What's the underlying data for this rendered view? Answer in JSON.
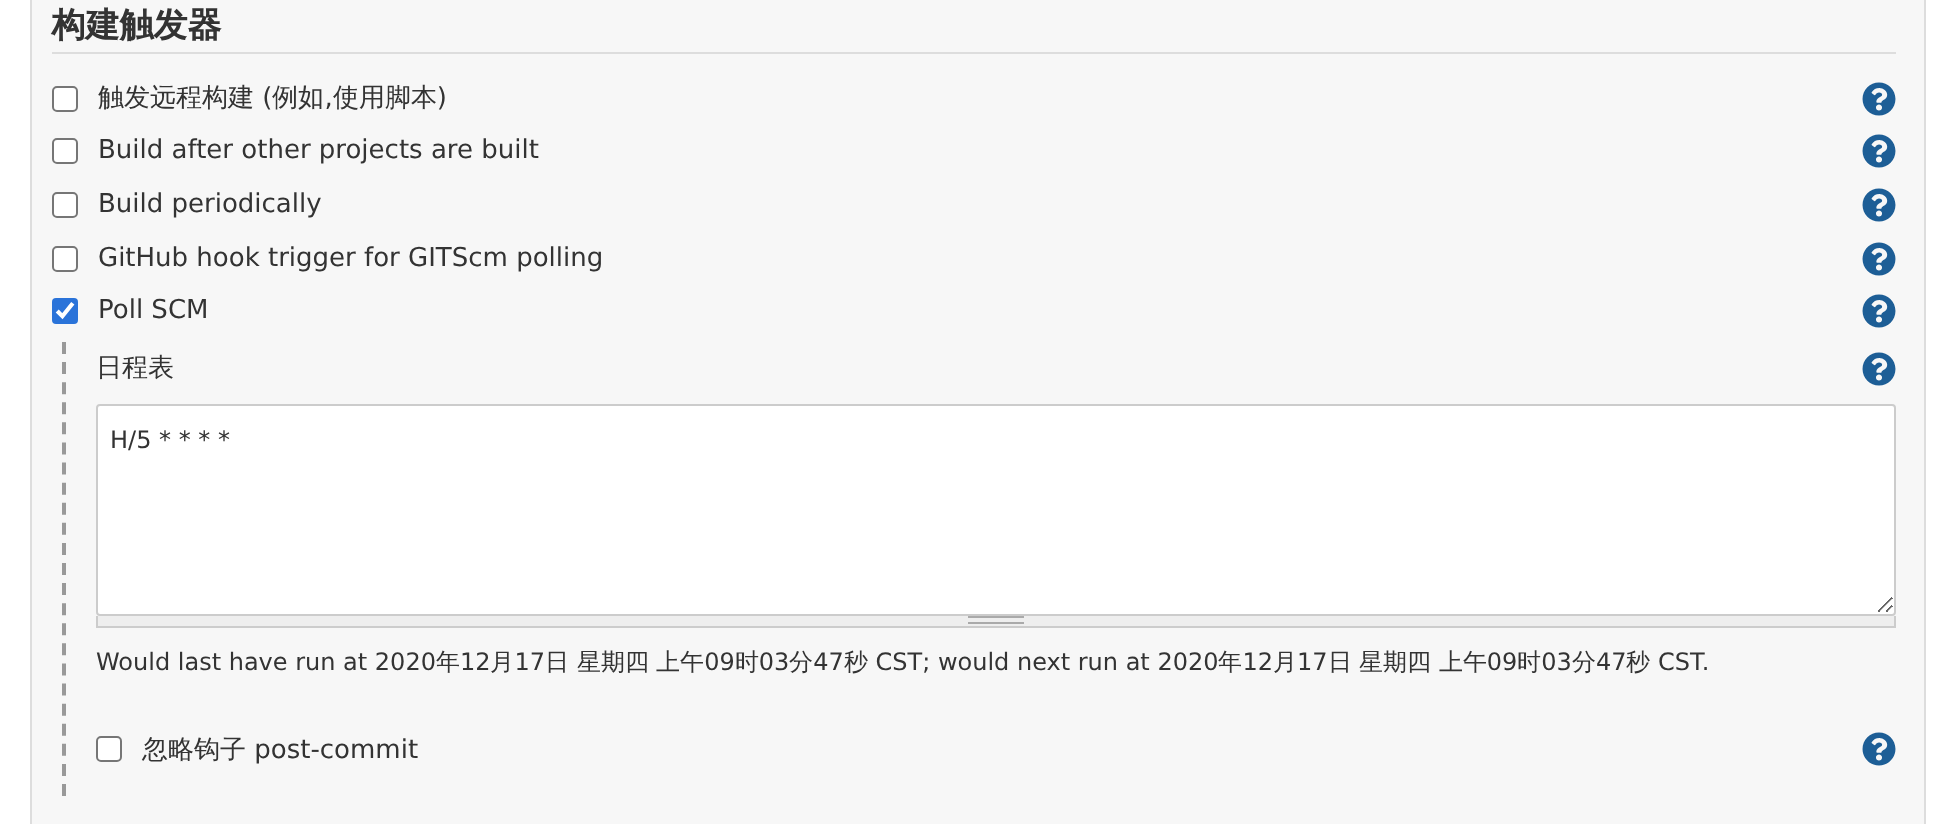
{
  "section": {
    "title": "构建触发器"
  },
  "triggers": [
    {
      "label": "触发远程构建 (例如,使用脚本)",
      "checked": false
    },
    {
      "label": "Build after other projects are built",
      "checked": false
    },
    {
      "label": "Build periodically",
      "checked": false
    },
    {
      "label": "GitHub hook trigger for GITScm polling",
      "checked": false
    },
    {
      "label": "Poll SCM",
      "checked": true
    }
  ],
  "poll_scm": {
    "schedule_label": "日程表",
    "schedule_value": "H/5 * * * *",
    "info": "Would last have run at 2020年12月17日 星期四 上午09时03分47秒 CST; would next run at 2020年12月17日 星期四 上午09时03分47秒 CST.",
    "ignore_hook": {
      "label": "忽略钩子 post-commit",
      "checked": false
    }
  }
}
